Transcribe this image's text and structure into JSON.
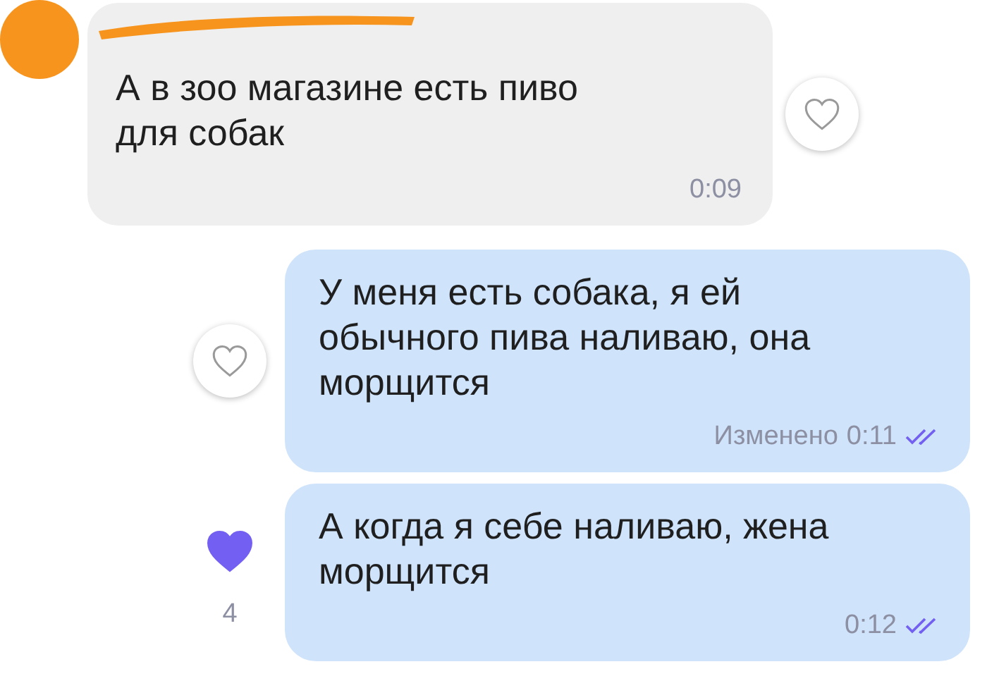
{
  "messages": [
    {
      "kind": "incoming",
      "text": "А в зоо магазине есть пиво для собак",
      "time": "0:09",
      "liked": false
    },
    {
      "kind": "outgoing",
      "text": "У меня есть собака, я ей обычного пива наливаю, она морщится",
      "edited_label": "Изменено",
      "time": "0:11",
      "read": true,
      "liked": false
    },
    {
      "kind": "outgoing",
      "text": "А когда я себе наливаю, жена морщится",
      "time": "0:12",
      "read": true,
      "liked": true,
      "likes": "4"
    }
  ]
}
